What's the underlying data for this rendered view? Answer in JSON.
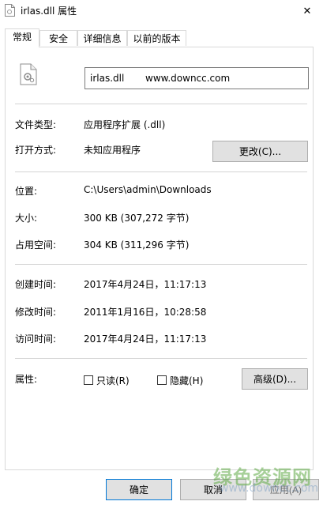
{
  "window": {
    "title": "irlas.dll 属性",
    "close_glyph": "✕"
  },
  "tabs": [
    {
      "label": "常规"
    },
    {
      "label": "安全"
    },
    {
      "label": "详细信息"
    },
    {
      "label": "以前的版本"
    }
  ],
  "general": {
    "file_name_value": "irlas.dll       www.downcc.com",
    "file_type_label": "文件类型:",
    "file_type_value": "应用程序扩展 (.dll)",
    "opens_with_label": "打开方式:",
    "opens_with_value": "未知应用程序",
    "change_button": "更改(C)...",
    "location_label": "位置:",
    "location_value": "C:\\Users\\admin\\Downloads",
    "size_label": "大小:",
    "size_value": "300 KB (307,272 字节)",
    "size_on_disk_label": "占用空间:",
    "size_on_disk_value": "304 KB (311,296 字节)",
    "created_label": "创建时间:",
    "created_value": "2017年4月24日，11:17:13",
    "modified_label": "修改时间:",
    "modified_value": "2011年1月16日，10:28:58",
    "accessed_label": "访问时间:",
    "accessed_value": "2017年4月24日，11:17:13",
    "attributes_label": "属性:",
    "readonly_label": "只读(R)",
    "readonly_checked": false,
    "hidden_label": "隐藏(H)",
    "hidden_checked": false,
    "advanced_button": "高级(D)..."
  },
  "footer": {
    "ok_button": "确定",
    "cancel_button": "取消",
    "apply_button": "应用(A)"
  },
  "watermark": {
    "main": "绿色资源网",
    "url": "www.downcc.com"
  },
  "colors": {
    "accent": "#0078d7",
    "button_bg": "#e1e1e1",
    "border": "#d9d9d9"
  }
}
